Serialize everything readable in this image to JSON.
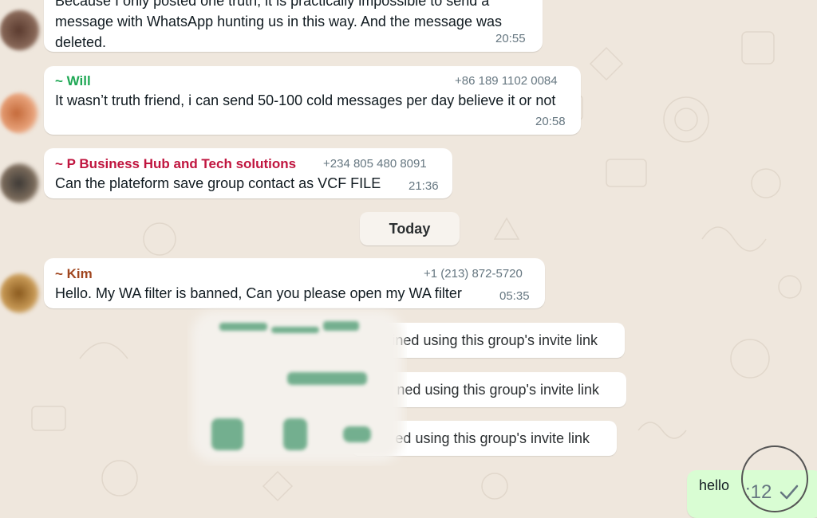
{
  "messages": [
    {
      "text": "Because I only posted one truth, it is practically impossible to send a message with WhatsApp hunting us in this way. And the message was deleted.",
      "time": "20:55"
    },
    {
      "sender": "~ Will",
      "phone": "+86 189 1102 0084",
      "text": "It wasn’t truth friend, i can send 50-100 cold messages per day believe it or not",
      "time": "20:58"
    },
    {
      "sender": "~ P Business Hub and Tech solutions",
      "phone": "+234 805 480 8091",
      "text": "Can the plateform save group contact as VCF FILE",
      "time": "21:36"
    },
    {
      "sender": "~ Kim",
      "phone": "+1 (213) 872-5720",
      "text": "Hello. My WA filter is banned, Can you please open my WA filter",
      "time": "05:35"
    }
  ],
  "date_divider": "Today",
  "system_notices": [
    "ined using this group's invite link",
    "ned using this group's invite link",
    "ed using this group's invite link"
  ],
  "outgoing": {
    "text": "hello",
    "time": ":12"
  },
  "colors": {
    "background": "#efe7dd",
    "will": "#1fa855",
    "p_business": "#c0153f",
    "kim": "#a0461f",
    "outgoing_bubble": "#d9fdd3"
  },
  "icons": [
    "avatar",
    "single-check-icon"
  ]
}
